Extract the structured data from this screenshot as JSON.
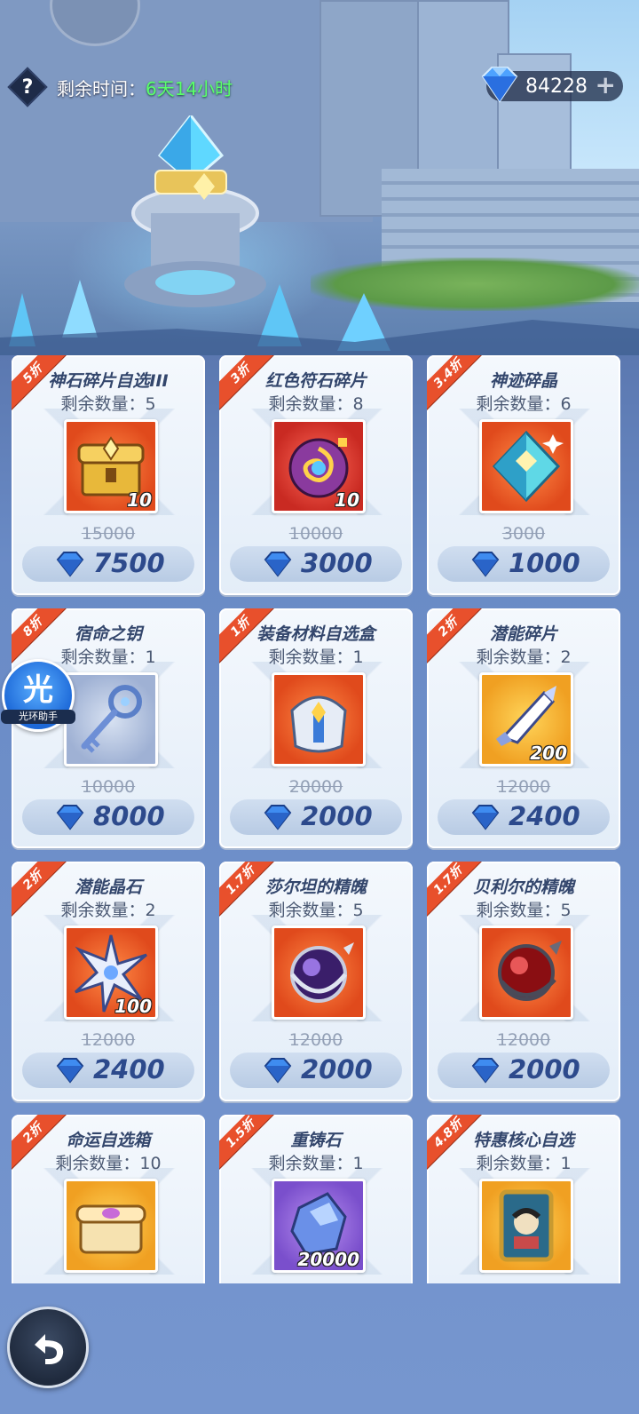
{
  "header": {
    "timer_label": "剩余时间：",
    "timer_value": "6天14小时",
    "help_icon": "?",
    "currency_amount": "84228",
    "currency_plus": "+"
  },
  "helper": {
    "glyph": "光",
    "label": "光环助手"
  },
  "colors": {
    "accent": "#2d4a8c",
    "discount_ribbon": "#e8502c",
    "timer_green": "#5bff6a"
  },
  "items": [
    {
      "discount": "5折",
      "name": "神石碎片自选III",
      "stock": "剩余数量：5",
      "qty": "10",
      "original": "15000",
      "price": "7500",
      "icon": "golden-chest-icon",
      "bg": "orange"
    },
    {
      "discount": "3折",
      "name": "红色符石碎片",
      "stock": "剩余数量：8",
      "qty": "10",
      "original": "10000",
      "price": "3000",
      "icon": "red-rune-shard-icon",
      "bg": "red"
    },
    {
      "discount": "3.4折",
      "name": "神迹碎晶",
      "stock": "剩余数量：6",
      "qty": "",
      "original": "3000",
      "price": "1000",
      "icon": "miracle-crystal-icon",
      "bg": "orange"
    },
    {
      "discount": "8折",
      "name": "宿命之钥",
      "stock": "剩余数量：1",
      "qty": "",
      "original": "10000",
      "price": "8000",
      "icon": "destiny-key-icon",
      "bg": "silver"
    },
    {
      "discount": "1折",
      "name": "装备材料自选盒",
      "stock": "剩余数量：1",
      "qty": "",
      "original": "20000",
      "price": "2000",
      "icon": "equipment-box-icon",
      "bg": "orange"
    },
    {
      "discount": "2折",
      "name": "潜能碎片",
      "stock": "剩余数量：2",
      "qty": "200",
      "original": "12000",
      "price": "2400",
      "icon": "potential-shard-icon",
      "bg": "gold"
    },
    {
      "discount": "2折",
      "name": "潜能晶石",
      "stock": "剩余数量：2",
      "qty": "100",
      "original": "12000",
      "price": "2400",
      "icon": "potential-star-icon",
      "bg": "orange"
    },
    {
      "discount": "1.7折",
      "name": "莎尔坦的精魄",
      "stock": "剩余数量：5",
      "qty": "",
      "original": "12000",
      "price": "2000",
      "icon": "purple-orb-icon",
      "bg": "orange"
    },
    {
      "discount": "1.7折",
      "name": "贝利尔的精魄",
      "stock": "剩余数量：5",
      "qty": "",
      "original": "12000",
      "price": "2000",
      "icon": "red-orb-icon",
      "bg": "orange"
    },
    {
      "discount": "2折",
      "name": "命运自选箱",
      "stock": "剩余数量：10",
      "qty": "",
      "original": "",
      "price": "",
      "icon": "fate-chest-icon",
      "bg": "gold"
    },
    {
      "discount": "1.5折",
      "name": "重铸石",
      "stock": "剩余数量：1",
      "qty": "20000",
      "original": "",
      "price": "",
      "icon": "reforge-stone-icon",
      "bg": "purple"
    },
    {
      "discount": "4.8折",
      "name": "特惠核心自选",
      "stock": "剩余数量：1",
      "qty": "",
      "original": "",
      "price": "",
      "icon": "core-card-icon",
      "bg": "gold"
    }
  ]
}
